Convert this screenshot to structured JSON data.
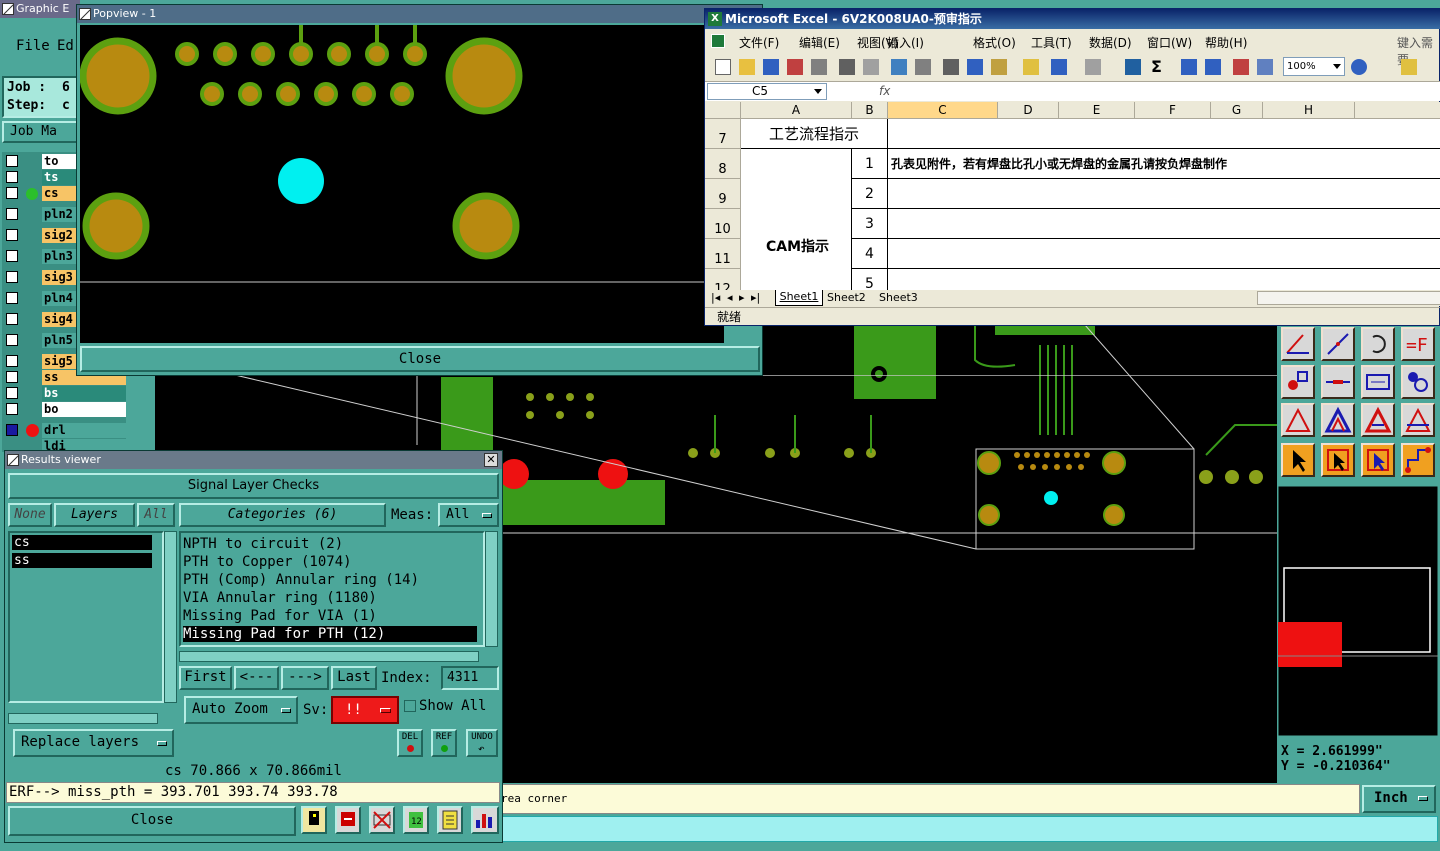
{
  "graphic_editor": {
    "title": "Graphic E",
    "menu": {
      "file": "File",
      "edit": "Ed"
    },
    "job_label": "Job :",
    "job_value": "6",
    "step_label": "Step:",
    "step_value": "c",
    "job_matrix": "Job Ma",
    "layers": [
      {
        "name": "to",
        "color": "#ffffff"
      },
      {
        "name": "ts",
        "color": "#2a8a7a"
      },
      {
        "name": "cs",
        "color": "#f7c466"
      },
      {
        "name": "pln2",
        "color": "#4ca79a"
      },
      {
        "name": "sig2",
        "color": "#f7c466"
      },
      {
        "name": "pln3",
        "color": "#4ca79a"
      },
      {
        "name": "sig3",
        "color": "#f7c466"
      },
      {
        "name": "pln4",
        "color": "#4ca79a"
      },
      {
        "name": "sig4",
        "color": "#f7c466"
      },
      {
        "name": "pln5",
        "color": "#4ca79a"
      },
      {
        "name": "sig5",
        "color": "#f7c466"
      },
      {
        "name": "ss",
        "color": "#f7c466"
      },
      {
        "name": "bs",
        "color": "#2a8a7a"
      },
      {
        "name": "bo",
        "color": "#ffffff"
      },
      {
        "name": "drl",
        "color": "#4ca79a"
      },
      {
        "name": "ldi",
        "color": "#4ca79a"
      }
    ],
    "status_text": "rea corner",
    "units": "Inch",
    "coord_x": "X = 2.661999\"",
    "coord_y": "Y = -0.210364\""
  },
  "popview": {
    "title": "Popview - 1",
    "close": "Close"
  },
  "excel": {
    "title": "Microsoft Excel - 6V2K008UA0-预审指示",
    "menu": [
      "文件(F)",
      "编辑(E)",
      "视图(V)",
      "插入(I)",
      "格式(O)",
      "工具(T)",
      "数据(D)",
      "窗口(W)",
      "帮助(H)"
    ],
    "help_prompt": "键入需要",
    "zoom": "100%",
    "name_box": "C5",
    "fx": "fx",
    "columns": [
      "A",
      "B",
      "C",
      "D",
      "E",
      "F",
      "G",
      "H"
    ],
    "rows": [
      "7",
      "8",
      "9",
      "10",
      "11",
      "12"
    ],
    "a7": "工艺流程指示",
    "a_cam": "CAM指示",
    "b_values": [
      "1",
      "2",
      "3",
      "4",
      "5"
    ],
    "c8": "孔表见附件，若有焊盘比孔小或无焊盘的金属孔请按负焊盘制作",
    "sheets": [
      "Sheet1",
      "Sheet2",
      "Sheet3"
    ],
    "status": "就绪"
  },
  "results_viewer": {
    "title": "Results viewer",
    "heading": "Signal Layer Checks",
    "none": "None",
    "layers_label": "Layers",
    "all": "All",
    "categories_label": "Categories (6)",
    "meas_label": "Meas:",
    "meas_value": "All",
    "layer_items": [
      "cs",
      "ss"
    ],
    "categories": [
      "NPTH to circuit (2)",
      "PTH to Copper (1074)",
      "PTH (Comp) Annular ring (14)",
      "VIA Annular ring (1180)",
      "Missing Pad for VIA (1)",
      "Missing Pad for PTH (12)"
    ],
    "first": "First",
    "prev": "<---",
    "next": "--->",
    "last": "Last",
    "index_label": "Index:",
    "index_value": "4311",
    "auto_zoom": "Auto Zoom",
    "sv_label": "Sv:",
    "sv_value": "!!",
    "show_all": "Show All",
    "replace_layers": "Replace layers",
    "del": "DEL",
    "ref": "REF",
    "undo": "UNDO",
    "size_info": "cs 70.866 x 70.866mil",
    "erf_line": "ERF--> miss_pth = 393.701 393.74 393.78",
    "close": "Close"
  }
}
